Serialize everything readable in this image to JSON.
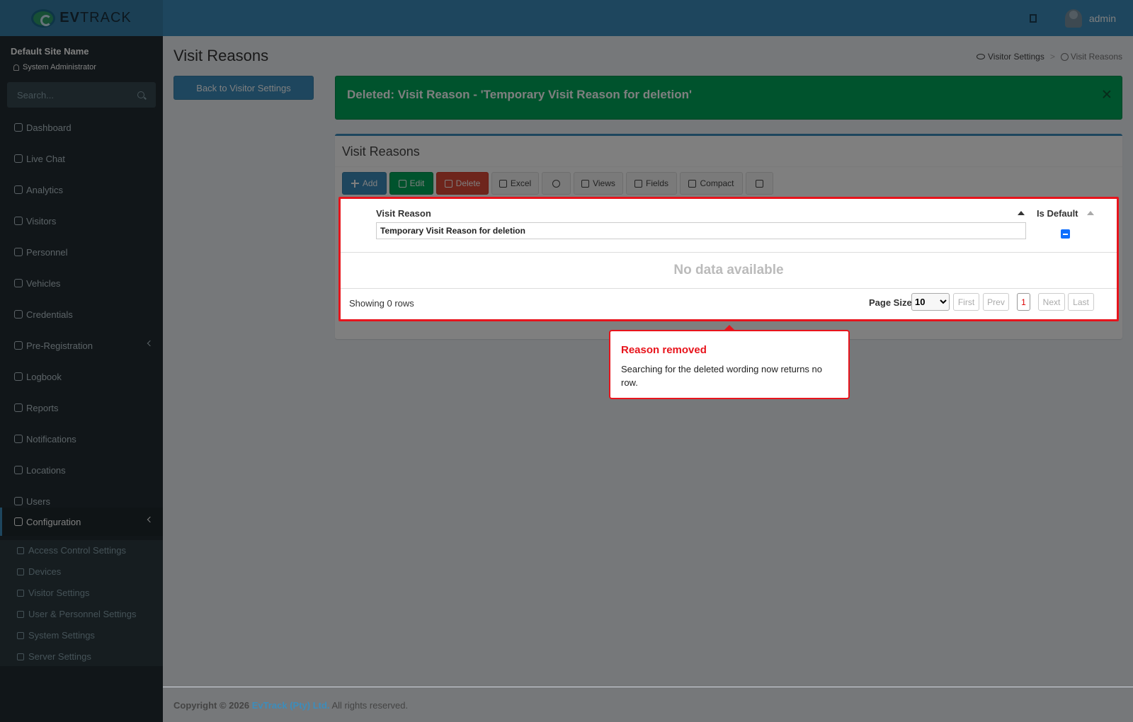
{
  "header": {
    "logo_text_bold": "EV",
    "logo_text_rest": "TRACK",
    "username": "admin"
  },
  "sidebar": {
    "site_name": "Default Site Name",
    "role": "System Administrator",
    "search_placeholder": "Search...",
    "items": [
      {
        "label": "Dashboard"
      },
      {
        "label": "Live Chat"
      },
      {
        "label": "Analytics"
      },
      {
        "label": "Visitors"
      },
      {
        "label": "Personnel"
      },
      {
        "label": "Vehicles"
      },
      {
        "label": "Credentials"
      },
      {
        "label": "Pre-Registration"
      },
      {
        "label": "Logbook"
      },
      {
        "label": "Reports"
      },
      {
        "label": "Notifications"
      },
      {
        "label": "Locations"
      },
      {
        "label": "Users"
      },
      {
        "label": "Configuration"
      }
    ],
    "submenu": [
      {
        "label": "Access Control Settings"
      },
      {
        "label": "Devices"
      },
      {
        "label": "Visitor Settings"
      },
      {
        "label": "User & Personnel Settings"
      },
      {
        "label": "System Settings"
      },
      {
        "label": "Server Settings"
      }
    ]
  },
  "page": {
    "title": "Visit Reasons",
    "breadcrumb_parent": "Visitor Settings",
    "breadcrumb_current": "Visit Reasons",
    "back_button": "Back to Visitor Settings",
    "alert_text": "Deleted: Visit Reason - 'Temporary Visit Reason for deletion'"
  },
  "grid": {
    "box_title": "Visit Reasons",
    "toolbar": {
      "add": "Add",
      "edit": "Edit",
      "delete": "Delete",
      "excel": "Excel",
      "views": "Views",
      "fields": "Fields",
      "compact": "Compact"
    },
    "columns": [
      "Visit Reason",
      "Is Default"
    ],
    "filter_value": "Temporary Visit Reason for deletion",
    "no_data": "No data available",
    "showing": "Showing 0 rows",
    "page_size_label": "Page Size",
    "page_size": "10",
    "pager": {
      "first": "First",
      "prev": "Prev",
      "current": "1",
      "next": "Next",
      "last": "Last"
    }
  },
  "callout": {
    "title": "Reason removed",
    "body": "Searching for the deleted wording now returns no row."
  },
  "footer": {
    "copyright": "Copyright © 2026",
    "company": "EvTrack (Pty) Ltd.",
    "rights": "All rights reserved."
  },
  "colors": {
    "primary": "#3c8dbc",
    "success": "#00a65a",
    "danger": "#dd4b39",
    "highlight": "#e8141c"
  }
}
